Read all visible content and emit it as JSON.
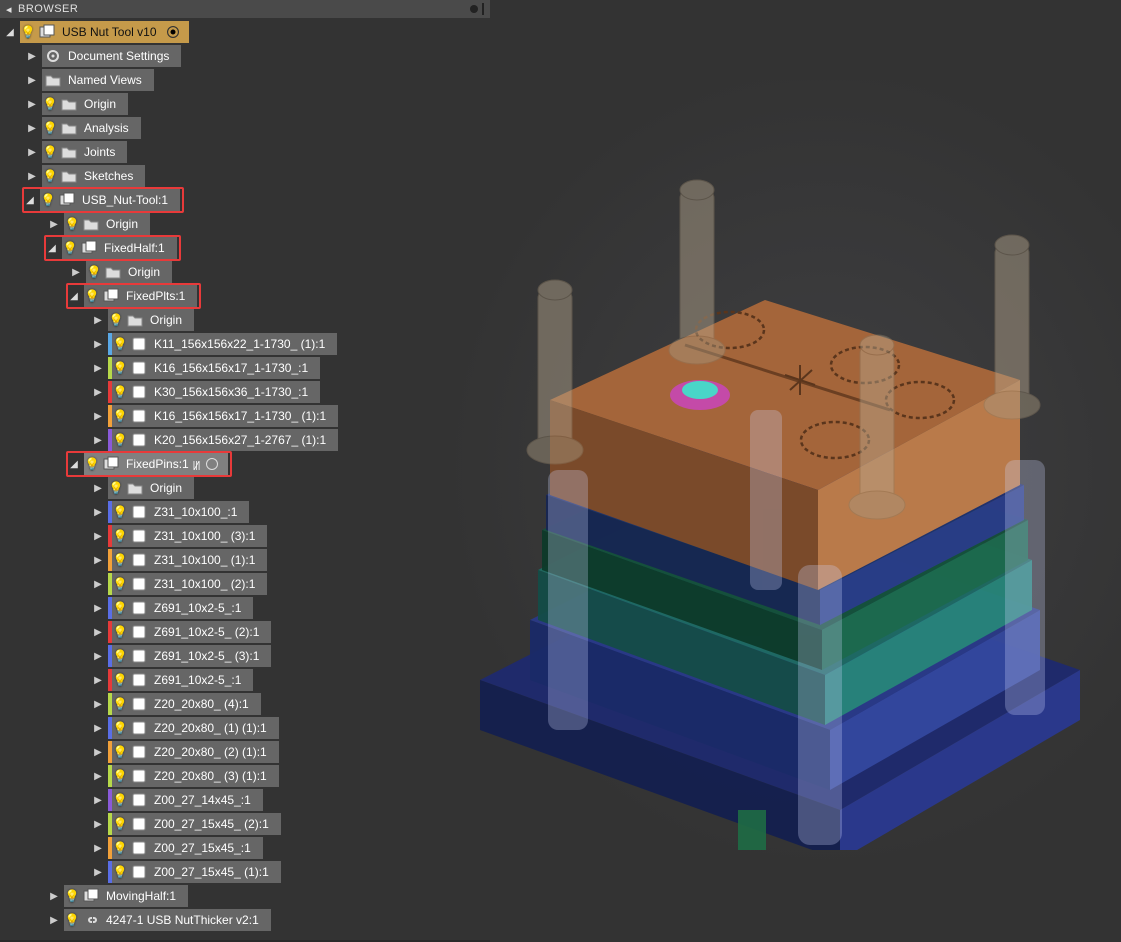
{
  "panel": {
    "title": "BROWSER"
  },
  "root": {
    "label": "USB Nut Tool v10"
  },
  "top_items": {
    "doc_settings": "Document Settings",
    "named_views": "Named Views",
    "origin": "Origin",
    "analysis": "Analysis",
    "joints": "Joints",
    "sketches": "Sketches"
  },
  "usb_nut_tool": {
    "label": "USB_Nut-Tool:1",
    "origin": "Origin",
    "fixed_half": {
      "label": "FixedHalf:1",
      "origin": "Origin",
      "fixed_plts": {
        "label": "FixedPlts:1",
        "origin": "Origin",
        "items": [
          "K11_156x156x22_1-1730_ (1):1",
          "K16_156x156x17_1-1730_:1",
          "K30_156x156x36_1-1730_:1",
          "K16_156x156x17_1-1730_ (1):1",
          "K20_156x156x27_1-2767_ (1):1"
        ]
      },
      "fixed_pins": {
        "label": "FixedPins:1",
        "origin": "Origin",
        "items": [
          "Z31_10x100_:1",
          "Z31_10x100_ (3):1",
          "Z31_10x100_ (1):1",
          "Z31_10x100_ (2):1",
          "Z691_10x2-5_:1",
          "Z691_10x2-5_ (2):1",
          "Z691_10x2-5_ (3):1",
          "Z691_10x2-5_:1",
          "Z20_20x80_ (4):1",
          "Z20_20x80_ (1) (1):1",
          "Z20_20x80_ (2) (1):1",
          "Z20_20x80_ (3) (1):1",
          "Z00_27_14x45_:1",
          "Z00_27_15x45_ (2):1",
          "Z00_27_15x45_:1",
          "Z00_27_15x45_ (1):1"
        ]
      }
    },
    "moving_half": "MovingHalf:1",
    "linked": "4247-1 USB NutThicker v2:1"
  },
  "colors": {
    "plts": [
      "#5aa8e6",
      "#b7d94a",
      "#e63a3a",
      "#f2a13a",
      "#8a5ad9"
    ],
    "pins": [
      "#5a6ee6",
      "#e63a3a",
      "#f2a13a",
      "#b7d94a",
      "#5a6ee6",
      "#e63a3a",
      "#5a6ee6",
      "#e63a3a",
      "#b7d94a",
      "#5a6ee6",
      "#f2a13a",
      "#b7d94a",
      "#8a5ad9",
      "#b7d94a",
      "#f2a13a",
      "#5a6ee6"
    ]
  }
}
